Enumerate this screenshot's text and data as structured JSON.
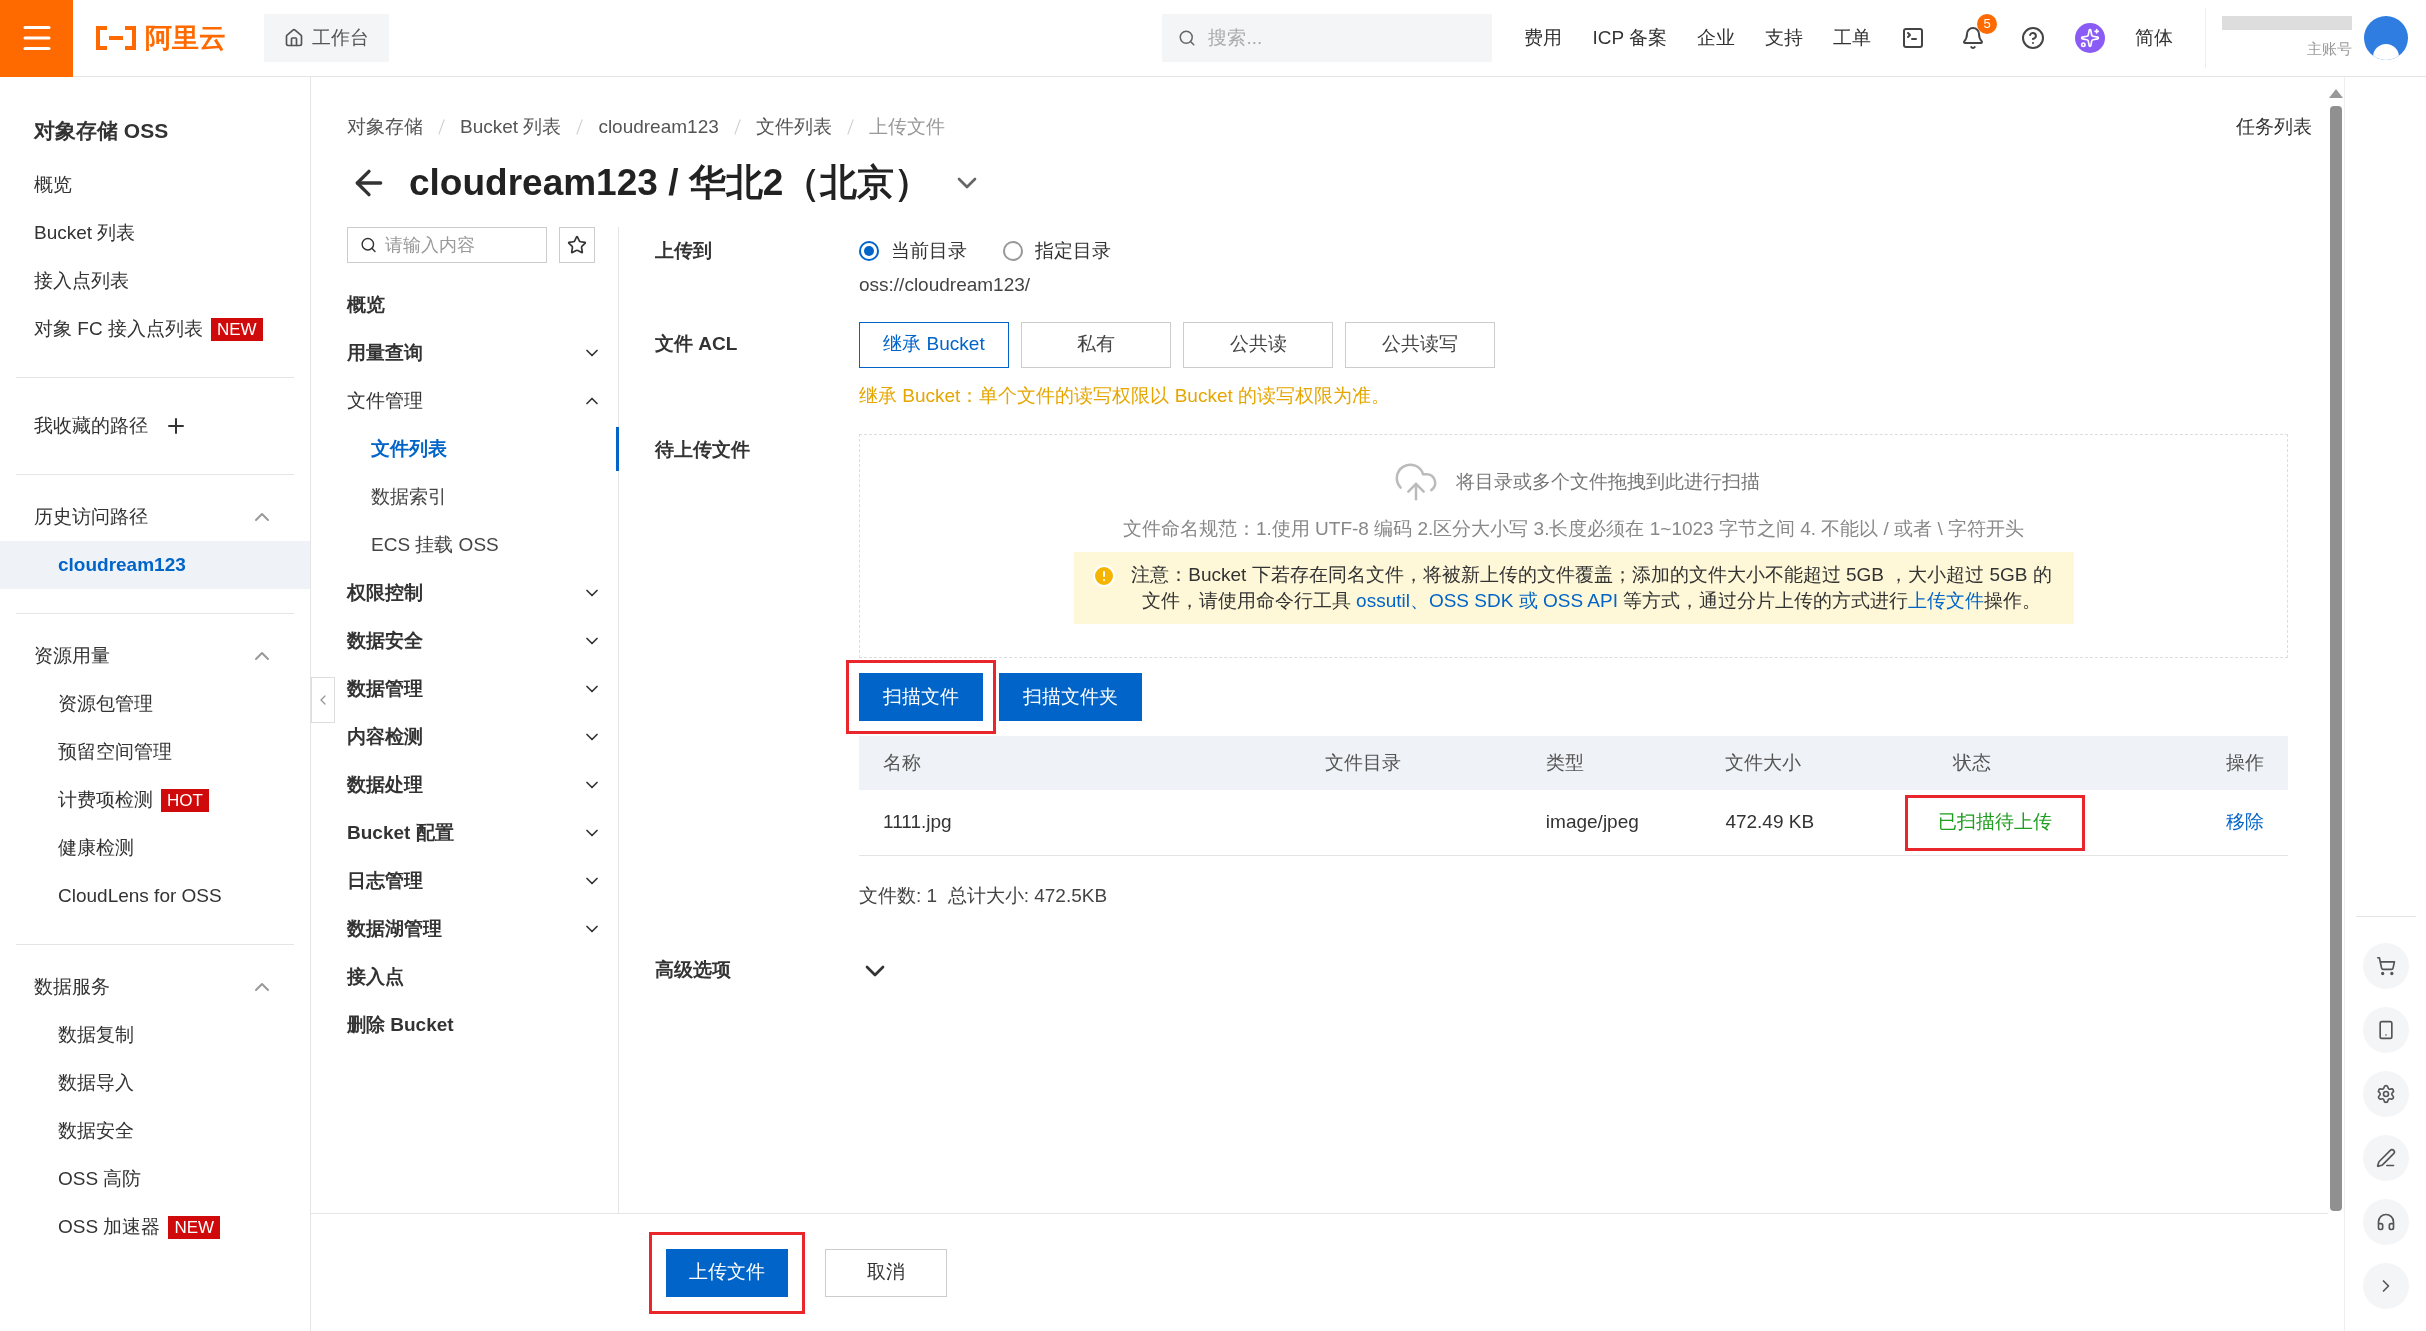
{
  "topbar": {
    "brand": "阿里云",
    "workbench": "工作台",
    "search_placeholder": "搜索...",
    "nav": [
      "费用",
      "ICP 备案",
      "企业",
      "支持",
      "工单"
    ],
    "notification_count": "5",
    "language": "简体",
    "account_label": "主账号"
  },
  "sidebar": {
    "title": "对象存储 OSS",
    "items": [
      {
        "label": "概览"
      },
      {
        "label": "Bucket 列表"
      },
      {
        "label": "接入点列表"
      },
      {
        "label": "对象 FC 接入点列表",
        "badge": "NEW"
      }
    ],
    "favorites": "我收藏的路径",
    "sections": [
      {
        "title": "历史访问路径",
        "expanded": true,
        "items": [
          {
            "label": "cloudream123",
            "selected": true
          }
        ]
      },
      {
        "title": "资源用量",
        "expanded": true,
        "items": [
          {
            "label": "资源包管理",
            "selected": false
          },
          {
            "label": "预留空间管理",
            "selected": false
          },
          {
            "label": "计费项检测",
            "badge": "HOT",
            "selected": false
          },
          {
            "label": "健康检测",
            "selected": false
          },
          {
            "label": "CloudLens for OSS",
            "selected": false
          }
        ]
      },
      {
        "title": "数据服务",
        "expanded": true,
        "items": [
          {
            "label": "数据复制",
            "selected": false
          },
          {
            "label": "数据导入",
            "selected": false
          },
          {
            "label": "数据安全",
            "selected": false
          },
          {
            "label": "OSS 高防",
            "selected": false
          },
          {
            "label": "OSS 加速器",
            "badge": "NEW",
            "selected": false
          }
        ]
      }
    ]
  },
  "breadcrumbs": [
    "对象存储",
    "Bucket 列表",
    "cloudream123",
    "文件列表",
    "上传文件"
  ],
  "task_list": "任务列表",
  "title": "cloudream123 / 华北2（北京）",
  "bucket_nav": {
    "search_placeholder": "请输入内容",
    "items": [
      {
        "kind": "link",
        "label": "概览"
      },
      {
        "kind": "group",
        "label": "用量查询",
        "expanded": false
      },
      {
        "kind": "group",
        "label": "文件管理",
        "expanded": true,
        "children": [
          {
            "label": "文件列表",
            "selected": true
          },
          {
            "label": "数据索引",
            "selected": false
          },
          {
            "label": "ECS 挂载 OSS",
            "selected": false
          }
        ]
      },
      {
        "kind": "group",
        "label": "权限控制",
        "expanded": false
      },
      {
        "kind": "group",
        "label": "数据安全",
        "expanded": false
      },
      {
        "kind": "group",
        "label": "数据管理",
        "expanded": false
      },
      {
        "kind": "group",
        "label": "内容检测",
        "expanded": false
      },
      {
        "kind": "group",
        "label": "数据处理",
        "expanded": false
      },
      {
        "kind": "group",
        "label": "Bucket 配置",
        "expanded": false
      },
      {
        "kind": "group",
        "label": "日志管理",
        "expanded": false
      },
      {
        "kind": "group",
        "label": "数据湖管理",
        "expanded": false
      },
      {
        "kind": "link",
        "label": "接入点"
      },
      {
        "kind": "link",
        "label": "删除 Bucket"
      }
    ]
  },
  "form": {
    "upload_to": {
      "label": "上传到",
      "options": [
        {
          "label": "当前目录",
          "selected": true
        },
        {
          "label": "指定目录",
          "selected": false
        }
      ],
      "path": "oss://cloudream123/"
    },
    "acl": {
      "label": "文件 ACL",
      "options": [
        {
          "label": "继承 Bucket",
          "selected": true
        },
        {
          "label": "私有",
          "selected": false
        },
        {
          "label": "公共读",
          "selected": false
        },
        {
          "label": "公共读写",
          "selected": false
        }
      ],
      "hint": "继承 Bucket：单个文件的读写权限以 Bucket 的读写权限为准。"
    },
    "pending": {
      "label": "待上传文件",
      "drop_text": "将目录或多个文件拖拽到此进行扫描",
      "naming_rules": "文件命名规范：1.使用 UTF-8 编码 2.区分大小写 3.长度必须在 1~1023 字节之间 4. 不能以 / 或者 \\ 字符开头",
      "notice": [
        {
          "text": "注意：Bucket 下若存在同名文件，将被新上传的文件覆盖；添加的文件大小不能超过 5GB ，大小超过 5GB 的文件，请使用命令行工具 ",
          "link": false
        },
        {
          "text": "ossutil、OSS SDK 或 OSS API",
          "link": true
        },
        {
          "text": " 等方式，通过分片上传的方式进行",
          "link": false
        },
        {
          "text": "上传文件",
          "link": true
        },
        {
          "text": "操作。",
          "link": false
        }
      ],
      "buttons": [
        {
          "label": "扫描文件",
          "highlighted": true
        },
        {
          "label": "扫描文件夹",
          "highlighted": false
        }
      ],
      "table": {
        "columns": [
          "名称",
          "文件目录",
          "类型",
          "文件大小",
          "状态",
          "操作"
        ],
        "rows": [
          {
            "name": "1111.jpg",
            "type": "image/jpeg",
            "size": "472.49 KB",
            "status": "已扫描待上传",
            "status_highlighted": true,
            "action": "移除"
          }
        ]
      },
      "summary": "文件数: 1  总计大小: 472.5KB"
    },
    "advanced": {
      "label": "高级选项",
      "expanded": false
    }
  },
  "footer": {
    "buttons": [
      {
        "label": "上传文件",
        "kind": "primary",
        "highlighted": true
      },
      {
        "label": "取消",
        "kind": "secondary",
        "highlighted": false
      }
    ]
  }
}
